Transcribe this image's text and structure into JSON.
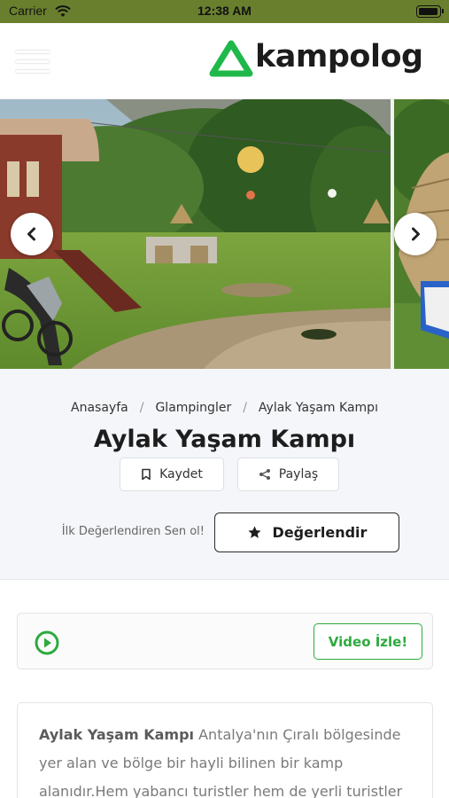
{
  "status_bar": {
    "carrier": "Carrier",
    "time": "12:38 AM"
  },
  "header": {
    "logo_text": "kampolog",
    "brand_color": "#1fb84a"
  },
  "gallery": {
    "prev_icon": "chevron-left-icon",
    "next_icon": "chevron-right-icon"
  },
  "breadcrumb": {
    "items": [
      "Anasayfa",
      "Glampingler",
      "Aylak Yaşam Kampı"
    ],
    "separator": "/"
  },
  "camp": {
    "title": "Aylak Yaşam Kampı",
    "save_label": "Kaydet",
    "share_label": "Paylaş",
    "rate_prompt": "İlk Değerlendiren Sen ol!",
    "rate_label": "Değerlendir"
  },
  "video": {
    "button_label": "Video İzle!",
    "accent_color": "#2eaa3e"
  },
  "description": {
    "name": "Aylak Yaşam Kampı",
    "text": " Antalya'nın Çıralı bölgesinde yer alan ve bölge bir hayli bilinen bir kamp alanıdır.Hem yabancı turistler hem de yerli turistler"
  }
}
